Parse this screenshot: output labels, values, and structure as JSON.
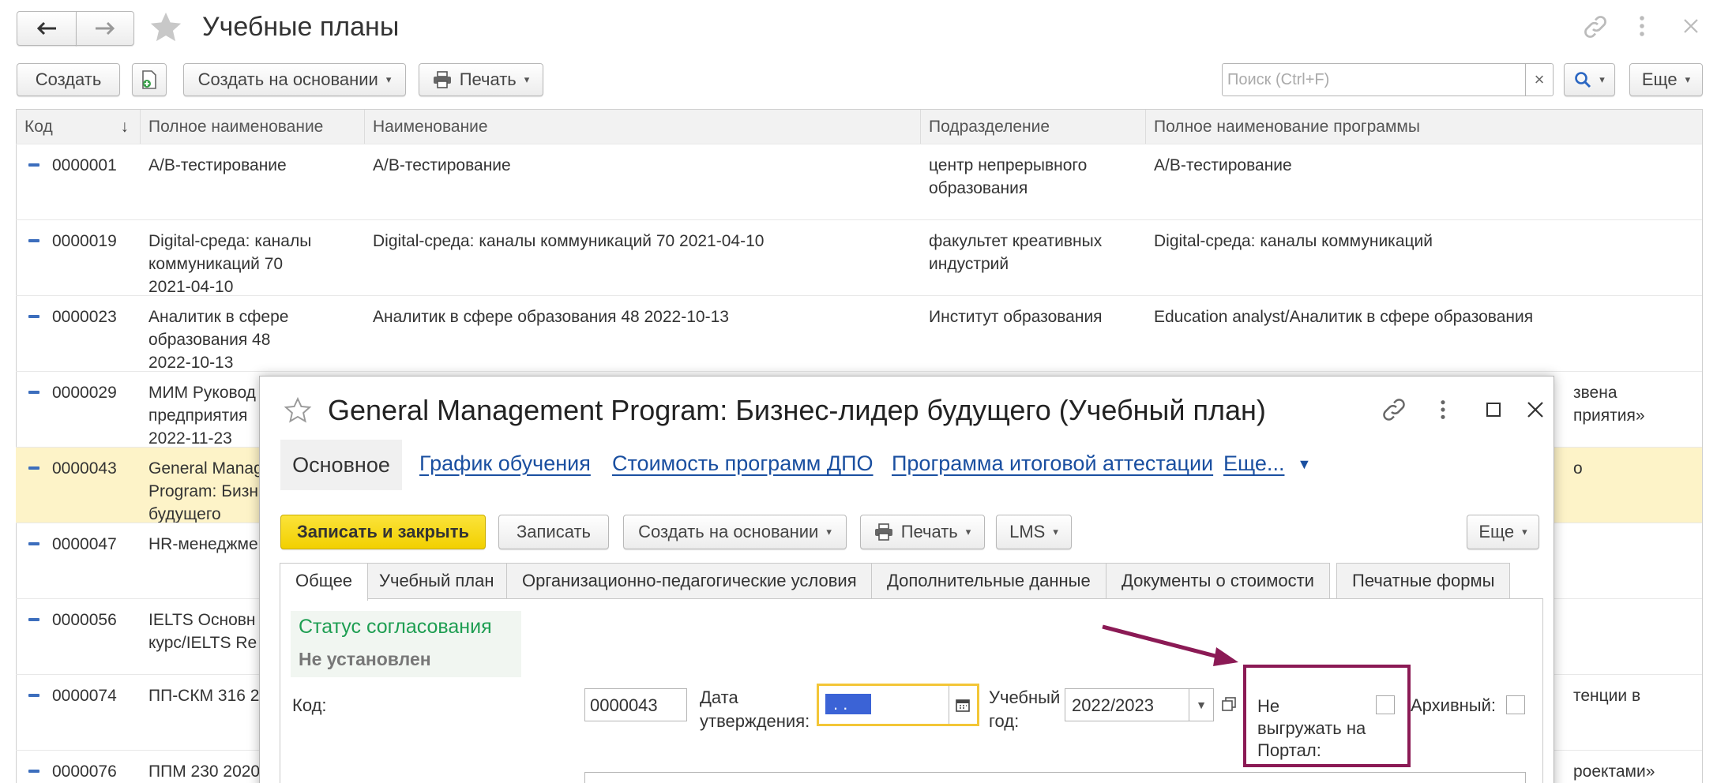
{
  "app": {
    "title": "Учебные планы",
    "create_label": "Создать",
    "create_based_label": "Создать на основании",
    "print_label": "Печать",
    "search_placeholder": "Поиск (Ctrl+F)",
    "clear_glyph": "×",
    "more_label": "Еще"
  },
  "table": {
    "columns": [
      "Код",
      "Полное наименование",
      "Наименование",
      "Подразделение",
      "Полное наименование программы"
    ],
    "sort_indicator": "↓",
    "rows": [
      {
        "code": "0000001",
        "full_name": "А/В-тестирование",
        "name": "А/В-тестирование",
        "dept": "центр непрерывного\nобразования",
        "program": "А/В-тестирование",
        "right": ""
      },
      {
        "code": "0000019",
        "full_name": "Digital-среда: каналы\nкоммуникаций 70\n2021-04-10",
        "name": "Digital-среда: каналы коммуникаций 70 2021-04-10",
        "dept": "факультет креативных\nиндустрий",
        "program": "Digital-среда: каналы коммуникаций",
        "right": ""
      },
      {
        "code": "0000023",
        "full_name": "Аналитик в сфере\nобразования 48\n2022-10-13",
        "name": "Аналитик в сфере образования 48 2022-10-13",
        "dept": "Институт образования",
        "program": "Education analyst/Аналитик в сфере образования",
        "right": ""
      },
      {
        "code": "0000029",
        "full_name": "МИМ Руковод\nпредприятия\n2022-11-23",
        "name": "",
        "dept": "",
        "program": "",
        "right": "звена\nприятия»"
      },
      {
        "code": "0000043",
        "full_name": "General Manag\nProgram: Бизн\nбудущего",
        "name": "",
        "dept": "",
        "program": "",
        "right": "о"
      },
      {
        "code": "0000047",
        "full_name": "HR-менеджме",
        "name": "",
        "dept": "",
        "program": "",
        "right": ""
      },
      {
        "code": "0000056",
        "full_name": "IELTS Основн\nкурс/IELTS Re",
        "name": "",
        "dept": "",
        "program": "",
        "right": ""
      },
      {
        "code": "0000074",
        "full_name": "ПП-СКМ 316 2",
        "name": "",
        "dept": "",
        "program": "",
        "right": "тенции в"
      },
      {
        "code": "0000076",
        "full_name": "ППМ 230 2020",
        "name": "",
        "dept": "",
        "program": "",
        "right": "роектами»"
      }
    ]
  },
  "dialog": {
    "title": "General Management Program: Бизнес-лидер будущего (Учебный план)",
    "nav": {
      "main": "Основное",
      "links": [
        "График обучения",
        "Стоимость программ ДПО",
        "Программа итоговой аттестации",
        "Еще..."
      ]
    },
    "toolbar": {
      "save_close": "Записать и закрыть",
      "save": "Записать",
      "create_based": "Создать на основании",
      "print": "Печать",
      "lms": "LMS",
      "more": "Еще"
    },
    "tabs": [
      "Общее",
      "Учебный план",
      "Организационно-педагогические условия",
      "Дополнительные данные",
      "Документы о стоимости",
      "Печатные формы"
    ],
    "status": {
      "label": "Статус согласования",
      "value": "Не установлен"
    },
    "fields": {
      "code_label": "Код:",
      "code_value": "0000043",
      "date_label": "Дата\nутверждения:",
      "date_value": ". .",
      "year_label": "Учебный\nгод:",
      "year_value": "2022/2023",
      "no_export_label": "Не\nвыгружать на\nПортал:",
      "archive_label": "Архивный:"
    }
  },
  "colors": {
    "accent_yellow": "#f5d61a",
    "selected_row": "#fdf3c8",
    "link_blue": "#1a4fa0",
    "status_green": "#1e9e52",
    "annotation": "#8b1a55"
  }
}
